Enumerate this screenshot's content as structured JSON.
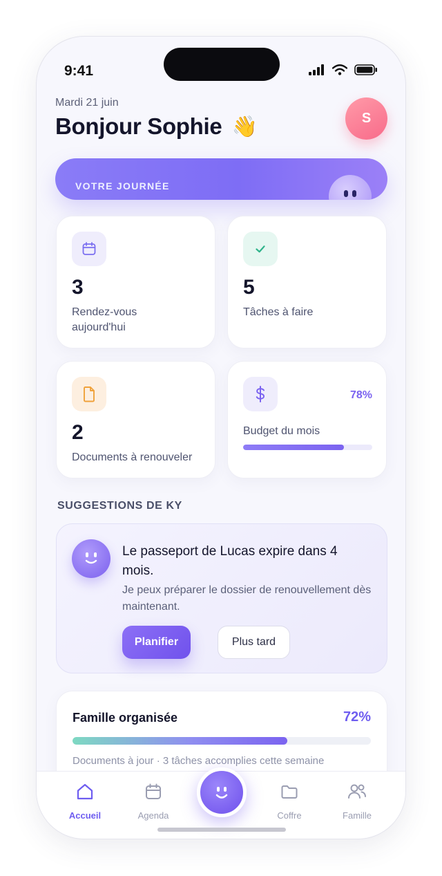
{
  "status": {
    "time": "9:41"
  },
  "header": {
    "date": "Mardi 21 juin",
    "greeting": "Bonjour Sophie",
    "wave": "👋",
    "avatar_initial": "S"
  },
  "banner": {
    "label": "VOTRE JOURNÉE"
  },
  "stats": {
    "appointments": {
      "value": "3",
      "label": "Rendez-vous aujourd'hui",
      "icon": "calendar-icon",
      "color": "#7b6ff0"
    },
    "tasks": {
      "value": "5",
      "label": "Tâches à faire",
      "icon": "check-icon",
      "color": "#2fb38a"
    },
    "documents": {
      "value": "2",
      "label": "Documents à renouveler",
      "icon": "document-icon",
      "color": "#f0a23b"
    },
    "budget": {
      "percent": "78%",
      "progress": 0.78,
      "label": "Budget du mois",
      "icon": "dollar-icon",
      "color": "#7b63f0"
    }
  },
  "suggestions": {
    "title": "SUGGESTIONS DE KY",
    "message": "Le passeport de Lucas expire dans 4 mois.",
    "detail": "Je peux préparer le dossier de renouvellement dès maintenant.",
    "primary_label": "Planifier",
    "secondary_label": "Plus tard"
  },
  "family": {
    "title": "Famille organisée",
    "percent": "72%",
    "progress": 0.72,
    "note": "Documents à jour · 3 tâches accomplies cette semaine"
  },
  "tabs": [
    {
      "label": "Accueil",
      "icon": "home-icon",
      "active": true
    },
    {
      "label": "Agenda",
      "icon": "calendar-icon"
    },
    {
      "label": "Coffre",
      "icon": "folder-icon"
    },
    {
      "label": "Famille",
      "icon": "users-icon"
    }
  ],
  "colors": {
    "accent": "#7b63f0",
    "background": "#f7f7fd"
  }
}
